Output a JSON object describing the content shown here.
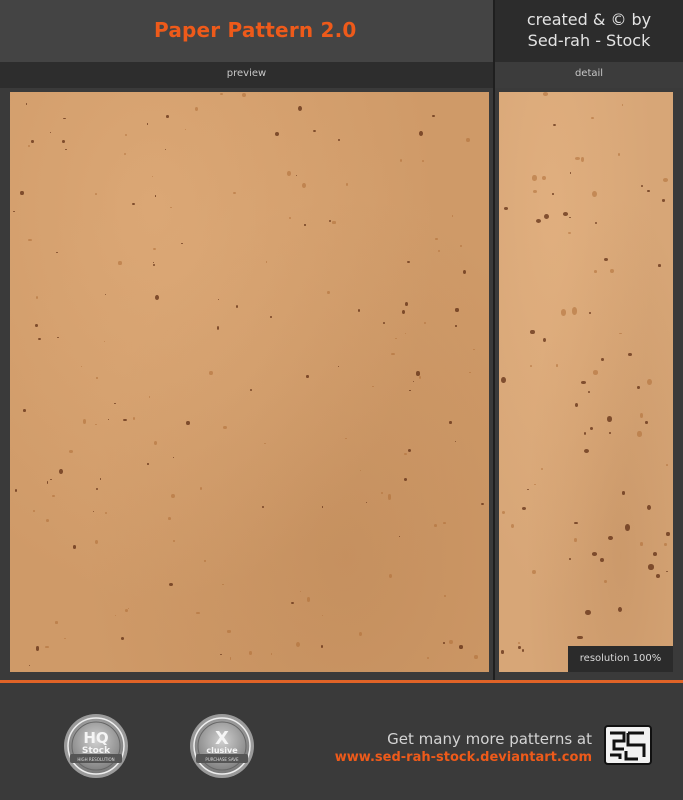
{
  "header": {
    "title": "Paper Pattern 2.0",
    "credit_line1": "created & © by",
    "credit_line2": "Sed-rah - Stock"
  },
  "panels": {
    "preview_label": "preview",
    "detail_label": "detail",
    "resolution_label": "resolution 100%"
  },
  "badges": {
    "hq": {
      "text_main": "HQ",
      "text_sub": "Stock",
      "ribbon": "HIGH RESOLUTION"
    },
    "exclusive": {
      "text_main": "X",
      "text_sub": "clusive",
      "ribbon": "PURCHASE SAVE"
    }
  },
  "footer": {
    "promo_line1": "Get many more patterns at",
    "promo_url": "www.sed-rah-stock.deviantart.com"
  },
  "colors": {
    "accent": "#ee5a1a",
    "paper": "#cf9a68",
    "background": "#3a3a3a"
  },
  "icons": {
    "logo": "sed-rah-logo-icon"
  }
}
